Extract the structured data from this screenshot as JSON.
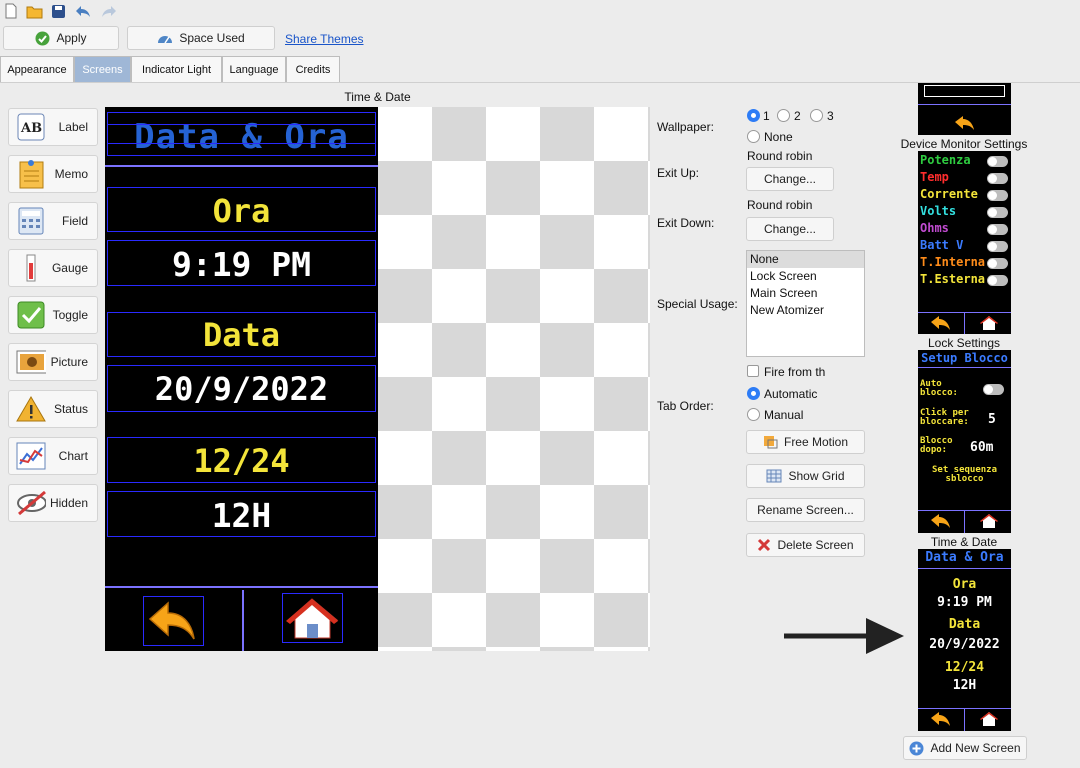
{
  "toolbar": {
    "icons": [
      "new-file-icon",
      "open-folder-icon",
      "save-icon",
      "undo-icon",
      "redo-icon"
    ],
    "apply_label": "Apply",
    "space_used_label": "Space Used",
    "share_themes_label": "Share Themes"
  },
  "tabs": [
    "Appearance",
    "Screens",
    "Indicator Light",
    "Language",
    "Credits"
  ],
  "selected_tab": "Screens",
  "widgets": [
    "Label",
    "Memo",
    "Field",
    "Gauge",
    "Toggle",
    "Picture",
    "Status",
    "Chart",
    "Hidden"
  ],
  "editor": {
    "title": "Time & Date",
    "title_text": "Data & Ora",
    "row1": "Ora",
    "row2": "9:19 PM",
    "row3": "Data",
    "row4": "20/9/2022",
    "row5": "12/24",
    "row6": "12H",
    "accent_blue": "#2563d4",
    "accent_yellow": "#f3e43a"
  },
  "props": {
    "wallpaper_label": "Wallpaper:",
    "wallpaper_opts": [
      "1",
      "2",
      "3",
      "None"
    ],
    "exit_up_label": "Exit Up:",
    "exit_up_value": "Round robin",
    "exit_down_label": "Exit Down:",
    "exit_down_value": "Round robin",
    "change_label": "Change...",
    "special_label": "Special Usage:",
    "special_options": [
      "None",
      "Lock Screen",
      "Main Screen",
      "New Atomizer"
    ],
    "fire_label": "Fire from th",
    "tab_order_label": "Tab Order:",
    "automatic_label": "Automatic",
    "manual_label": "Manual",
    "free_motion_label": "Free Motion",
    "show_grid_label": "Show Grid",
    "rename_label": "Rename Screen...",
    "delete_label": "Delete Screen"
  },
  "previews": {
    "dm_title": "Device Monitor Settings",
    "dm_items": [
      {
        "label": "Potenza",
        "color": "#2ecc40"
      },
      {
        "label": "Temp",
        "color": "#ff2d2d"
      },
      {
        "label": "Corrente",
        "color": "#f3e43a"
      },
      {
        "label": "Volts",
        "color": "#33e0e0"
      },
      {
        "label": "Ohms",
        "color": "#c04bd0"
      },
      {
        "label": "Batt V",
        "color": "#3b7bff"
      },
      {
        "label": "T.Interna",
        "color": "#ff8c1a"
      },
      {
        "label": "T.Esterna",
        "color": "#f3e43a"
      }
    ],
    "lock_title": "Lock Settings",
    "lock_header": "Setup Blocco",
    "lock_rows": [
      {
        "label": "Auto blocco:",
        "value": ""
      },
      {
        "label": "Click per bloccare:",
        "value": "5"
      },
      {
        "label": "Blocco dopo:",
        "value": "60m"
      }
    ],
    "lock_footer": "Set sequenza sblocco",
    "td_title": "Time & Date",
    "add_label": "Add New Screen"
  }
}
